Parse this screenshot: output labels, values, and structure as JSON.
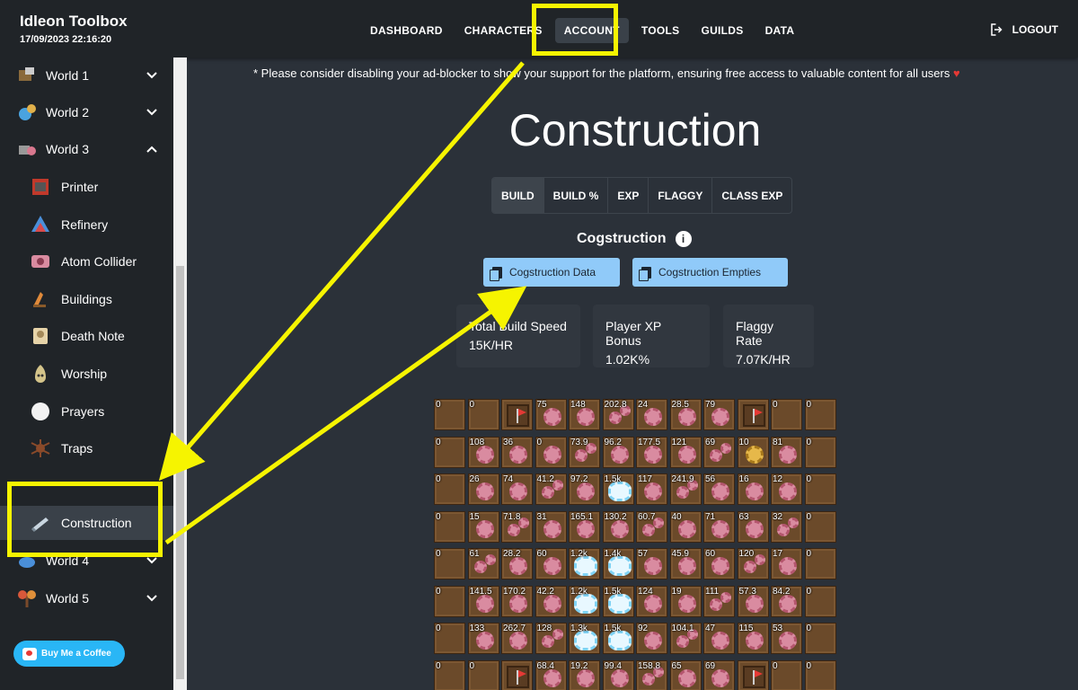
{
  "app": {
    "title": "Idleon Toolbox",
    "datetime": "17/09/2023 22:16:20"
  },
  "nav": [
    {
      "label": "DASHBOARD"
    },
    {
      "label": "CHARACTERS"
    },
    {
      "label": "ACCOUNT"
    },
    {
      "label": "TOOLS"
    },
    {
      "label": "GUILDS"
    },
    {
      "label": "DATA"
    }
  ],
  "logout": {
    "label": "LOGOUT"
  },
  "sidebar": {
    "items": [
      {
        "label": "World 1",
        "icon": "world1-icon"
      },
      {
        "label": "World 2",
        "icon": "world2-icon"
      },
      {
        "label": "World 3",
        "icon": "world3-icon"
      },
      {
        "label": "Printer",
        "icon": "printer-icon"
      },
      {
        "label": "Refinery",
        "icon": "refinery-icon"
      },
      {
        "label": "Atom Collider",
        "icon": "atom-collider-icon"
      },
      {
        "label": "Buildings",
        "icon": "buildings-icon"
      },
      {
        "label": "Death Note",
        "icon": "death-note-icon"
      },
      {
        "label": "Worship",
        "icon": "worship-icon"
      },
      {
        "label": "Prayers",
        "icon": "prayers-icon"
      },
      {
        "label": "Traps",
        "icon": "traps-icon"
      },
      {
        "label": "Construction",
        "icon": "construction-icon"
      },
      {
        "label": "World 4",
        "icon": "world4-icon"
      },
      {
        "label": "World 5",
        "icon": "world5-icon"
      }
    ],
    "coffee_label": "Buy Me a Coffee"
  },
  "main": {
    "ad_note": "* Please consider disabling your ad-blocker to show your support for the platform, ensuring free access to valuable content for all users",
    "heart": "♥",
    "title": "Construction",
    "tabs": [
      {
        "label": "BUILD"
      },
      {
        "label": "BUILD %"
      },
      {
        "label": "EXP"
      },
      {
        "label": "FLAGGY"
      },
      {
        "label": "CLASS EXP"
      }
    ],
    "section_title": "Cogstruction",
    "info": "i",
    "buttons": {
      "data": "Cogstruction Data",
      "empties": "Cogstruction Empties"
    },
    "stats": [
      {
        "label": "Total Build Speed",
        "value": "15K/HR"
      },
      {
        "label": "Player XP Bonus",
        "value": "1.02K%"
      },
      {
        "label": "Flaggy Rate",
        "value": "7.07K/HR"
      }
    ]
  },
  "board": {
    "rows": [
      [
        "0",
        "0",
        "F",
        "75",
        "148",
        "202.8",
        "24",
        "28.5",
        "79",
        "F",
        "0",
        "0"
      ],
      [
        "0",
        "108",
        "36",
        "0",
        "73.9",
        "96.2",
        "177.5",
        "121",
        "69",
        "10",
        "81",
        "0"
      ],
      [
        "0",
        "26",
        "74",
        "41.2",
        "97.2",
        "1.5k",
        "117",
        "241.9",
        "56",
        "16",
        "12",
        "0"
      ],
      [
        "0",
        "15",
        "71.8",
        "31",
        "165.1",
        "130.2",
        "60.7",
        "40",
        "71",
        "63",
        "32",
        "0"
      ],
      [
        "0",
        "61",
        "28.2",
        "60",
        "1.2k",
        "1.4k",
        "57",
        "45.9",
        "60",
        "120",
        "17",
        "0"
      ],
      [
        "0",
        "141.5",
        "170.2",
        "42.2",
        "1.2k",
        "1.5k",
        "124",
        "19",
        "111",
        "57.3",
        "84.2",
        "0"
      ],
      [
        "0",
        "133",
        "262.7",
        "128",
        "1.3k",
        "1.5k",
        "92",
        "104.1",
        "47",
        "115",
        "53",
        "0"
      ],
      [
        "0",
        "0",
        "F",
        "68.4",
        "19.2",
        "99.4",
        "158.8",
        "65",
        "69",
        "F",
        "0",
        "0"
      ]
    ]
  }
}
